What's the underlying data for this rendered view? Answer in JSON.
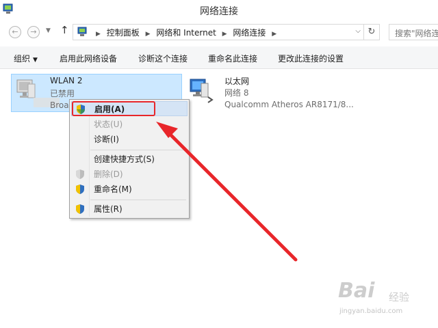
{
  "window": {
    "title": "网络连接"
  },
  "nav": {
    "breadcrumbs": [
      "控制面板",
      "网络和 Internet",
      "网络连接"
    ],
    "search_placeholder": "搜索\"网络连"
  },
  "toolbar": {
    "organize": "组织",
    "enable_device": "启用此网络设备",
    "diagnose": "诊断这个连接",
    "rename": "重命名此连接",
    "change_settings": "更改此连接的设置"
  },
  "connections": [
    {
      "name": "WLAN 2",
      "status": "已禁用",
      "device": "Broa",
      "selected": true
    },
    {
      "name": "以太网",
      "status": "网络  8",
      "device": "Qualcomm Atheros AR8171/8..."
    }
  ],
  "context_menu": {
    "items": [
      {
        "label": "启用(A)",
        "shield": true,
        "disabled": false,
        "highlighted": true
      },
      {
        "label": "状态(U)",
        "shield": false,
        "disabled": true
      },
      {
        "label": "诊断(I)",
        "shield": false,
        "disabled": false
      },
      {
        "label": "创建快捷方式(S)",
        "shield": false,
        "disabled": false
      },
      {
        "label": "删除(D)",
        "shield": true,
        "disabled": true
      },
      {
        "label": "重命名(M)",
        "shield": true,
        "disabled": false
      },
      {
        "label": "属性(R)",
        "shield": true,
        "disabled": false
      }
    ]
  },
  "annotation": {
    "color": "#e8262a"
  },
  "watermark": {
    "logo": "Bai",
    "logo_suffix": "经验",
    "url": "jingyan.baidu.com"
  }
}
